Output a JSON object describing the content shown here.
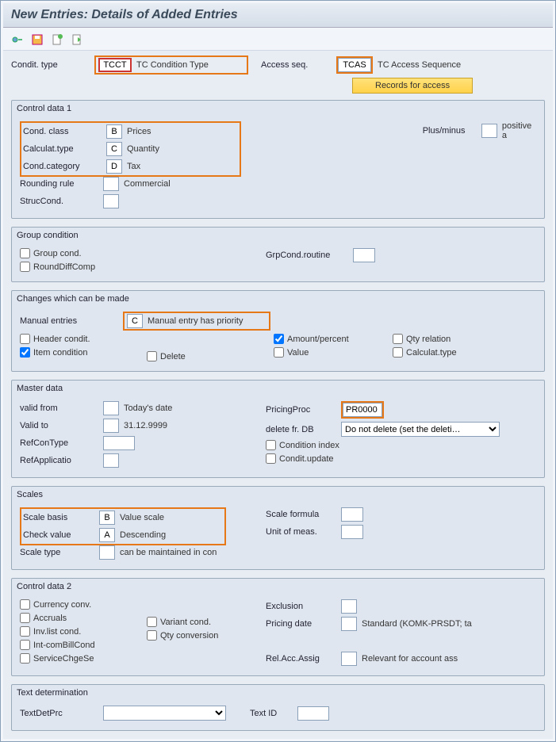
{
  "title": "New Entries: Details of Added Entries",
  "header": {
    "condit_type_lbl": "Condit. type",
    "condit_type_code": "TCCT",
    "condit_type_desc": "TC Condition Type",
    "access_seq_lbl": "Access seq.",
    "access_seq_code": "TCAS",
    "access_seq_desc": "TC Access Sequence",
    "records_btn": "Records for access"
  },
  "control1": {
    "legend": "Control data 1",
    "cond_class_lbl": "Cond. class",
    "cond_class_code": "B",
    "cond_class_desc": "Prices",
    "calc_type_lbl": "Calculat.type",
    "calc_type_code": "C",
    "calc_type_desc": "Quantity",
    "cond_cat_lbl": "Cond.category",
    "cond_cat_code": "D",
    "cond_cat_desc": "Tax",
    "rounding_lbl": "Rounding rule",
    "rounding_code": "",
    "rounding_desc": "Commercial",
    "struc_lbl": "StrucCond.",
    "struc_code": "",
    "plusminus_lbl": "Plus/minus",
    "plusminus_code": "",
    "plusminus_desc": "positive a"
  },
  "group_cond": {
    "legend": "Group condition",
    "group_cond_lbl": "Group cond.",
    "round_diff_lbl": "RoundDiffComp",
    "grp_routine_lbl": "GrpCond.routine",
    "grp_routine_val": ""
  },
  "changes": {
    "legend": "Changes which can be made",
    "manual_lbl": "Manual entries",
    "manual_code": "C",
    "manual_desc": "Manual entry has priority",
    "header_condit": "Header condit.",
    "item_condition": "Item condition",
    "delete": "Delete",
    "amount_pct": "Amount/percent",
    "value": "Value",
    "qty_rel": "Qty relation",
    "calc_type": "Calculat.type"
  },
  "master": {
    "legend": "Master data",
    "valid_from_lbl": "valid from",
    "valid_from_code": "",
    "valid_from_desc": "Today's date",
    "valid_to_lbl": "Valid to",
    "valid_to_code": "",
    "valid_to_desc": "31.12.9999",
    "refcontype_lbl": "RefConType",
    "refcontype_val": "",
    "refapp_lbl": "RefApplicatio",
    "refapp_val": "",
    "pricing_proc_lbl": "PricingProc",
    "pricing_proc_val": "PR0000",
    "delete_db_lbl": "delete fr. DB",
    "delete_db_val": "Do not delete (set the deleti…",
    "cond_index": "Condition index",
    "cond_update": "Condit.update"
  },
  "scales": {
    "legend": "Scales",
    "basis_lbl": "Scale basis",
    "basis_code": "B",
    "basis_desc": "Value scale",
    "check_lbl": "Check value",
    "check_code": "A",
    "check_desc": "Descending",
    "type_lbl": "Scale type",
    "type_code": "",
    "type_desc": "can be maintained in con",
    "formula_lbl": "Scale formula",
    "formula_val": "",
    "uom_lbl": "Unit of meas.",
    "uom_val": ""
  },
  "control2": {
    "legend": "Control data 2",
    "currency_conv": "Currency conv.",
    "accruals": "Accruals",
    "variant_cond": "Variant cond.",
    "inv_list": "Inv.list cond.",
    "qty_conv": "Qty conversion",
    "int_com": "Int-comBillCond",
    "service": "ServiceChgeSe",
    "exclusion_lbl": "Exclusion",
    "exclusion_val": "",
    "pricing_date_lbl": "Pricing date",
    "pricing_date_code": "",
    "pricing_date_desc": "Standard (KOMK-PRSDT; ta",
    "rel_acc_lbl": "Rel.Acc.Assig",
    "rel_acc_code": "",
    "rel_acc_desc": "Relevant for account ass"
  },
  "textdet": {
    "legend": "Text determination",
    "textdetprc_lbl": "TextDetPrc",
    "textid_lbl": "Text ID"
  }
}
